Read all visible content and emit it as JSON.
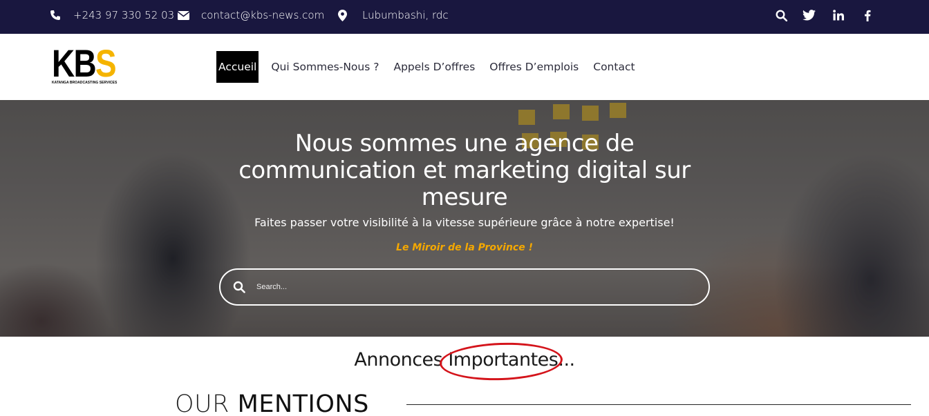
{
  "topbar": {
    "phone": "+243 97 330 52 03",
    "email": "contact@kbs-news.com",
    "location": "Lubumbashi, rdc",
    "icons": [
      "phone-icon",
      "envelope-icon",
      "map-marker-icon",
      "search-icon",
      "twitter-icon",
      "linkedin-icon",
      "facebook-icon"
    ]
  },
  "logo": {
    "letters_main": "KB",
    "letter_accent": "S",
    "subtitle": "KATANGA BROADCASTING SERVICES"
  },
  "nav": {
    "items": [
      "Accueil",
      "Qui Sommes-Nous ?",
      "Appels D’offres",
      "Offres D’emplois",
      "Contact"
    ],
    "active": "Accueil"
  },
  "hero": {
    "title": "Nous sommes une agence de communication et marketing digital sur mesure",
    "subtitle": "Faites passer votre visibilité à la vitesse supérieure grâce à notre expertise!",
    "tagline": "Le Miroir de la Province !",
    "search_placeholder": "Search..."
  },
  "announcement": {
    "word1": "Annonces",
    "word2": "Importantes",
    "suffix": "..."
  },
  "mentions": {
    "light": "OUR",
    "bold": "MENTIONS"
  },
  "colors": {
    "topbar_bg": "#19173f",
    "accent": "#f5b400",
    "tagline": "#f5a800",
    "circle": "#d4141b"
  }
}
